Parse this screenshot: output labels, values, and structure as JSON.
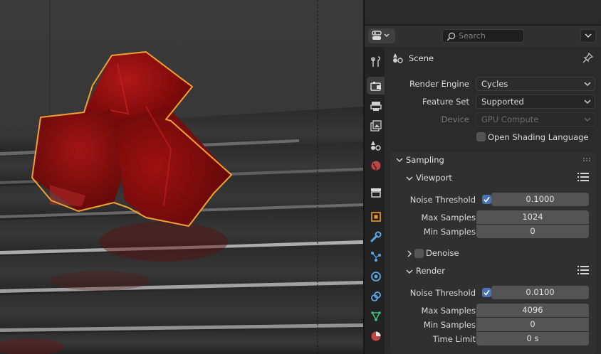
{
  "header": {
    "search_placeholder": "Search"
  },
  "context": {
    "label": "Scene"
  },
  "render_settings": {
    "render_engine_label": "Render Engine",
    "render_engine_value": "Cycles",
    "feature_set_label": "Feature Set",
    "feature_set_value": "Supported",
    "device_label": "Device",
    "device_value": "GPU Compute",
    "osl_label": "Open Shading Language",
    "osl_checked": false
  },
  "sampling": {
    "title": "Sampling",
    "viewport": {
      "title": "Viewport",
      "noise_threshold_label": "Noise Threshold",
      "noise_threshold_enabled": true,
      "noise_threshold_value": "0.1000",
      "max_samples_label": "Max Samples",
      "max_samples_value": "1024",
      "min_samples_label": "Min Samples",
      "min_samples_value": "0"
    },
    "denoise": {
      "title": "Denoise",
      "checked": false
    },
    "render": {
      "title": "Render",
      "noise_threshold_label": "Noise Threshold",
      "noise_threshold_enabled": true,
      "noise_threshold_value": "0.0100",
      "max_samples_label": "Max Samples",
      "max_samples_value": "4096",
      "min_samples_label": "Min Samples",
      "min_samples_value": "0",
      "time_limit_label": "Time Limit",
      "time_limit_value": "0 s"
    }
  },
  "tabs": [
    {
      "icon": "tool-icon"
    },
    {
      "icon": "render-icon",
      "active": true
    },
    {
      "icon": "output-icon"
    },
    {
      "icon": "view-layer-icon"
    },
    {
      "icon": "scene-icon"
    },
    {
      "icon": "world-icon"
    },
    {
      "icon": "collection-icon"
    },
    {
      "icon": "object-icon"
    },
    {
      "icon": "modifier-icon"
    },
    {
      "icon": "particles-icon"
    },
    {
      "icon": "physics-icon"
    },
    {
      "icon": "constraints-icon"
    },
    {
      "icon": "data-icon"
    },
    {
      "icon": "material-icon"
    }
  ],
  "colors": {
    "accent": "#4772b3",
    "selection_outline": "#f0a030",
    "object_red": "#9a0e0e"
  }
}
